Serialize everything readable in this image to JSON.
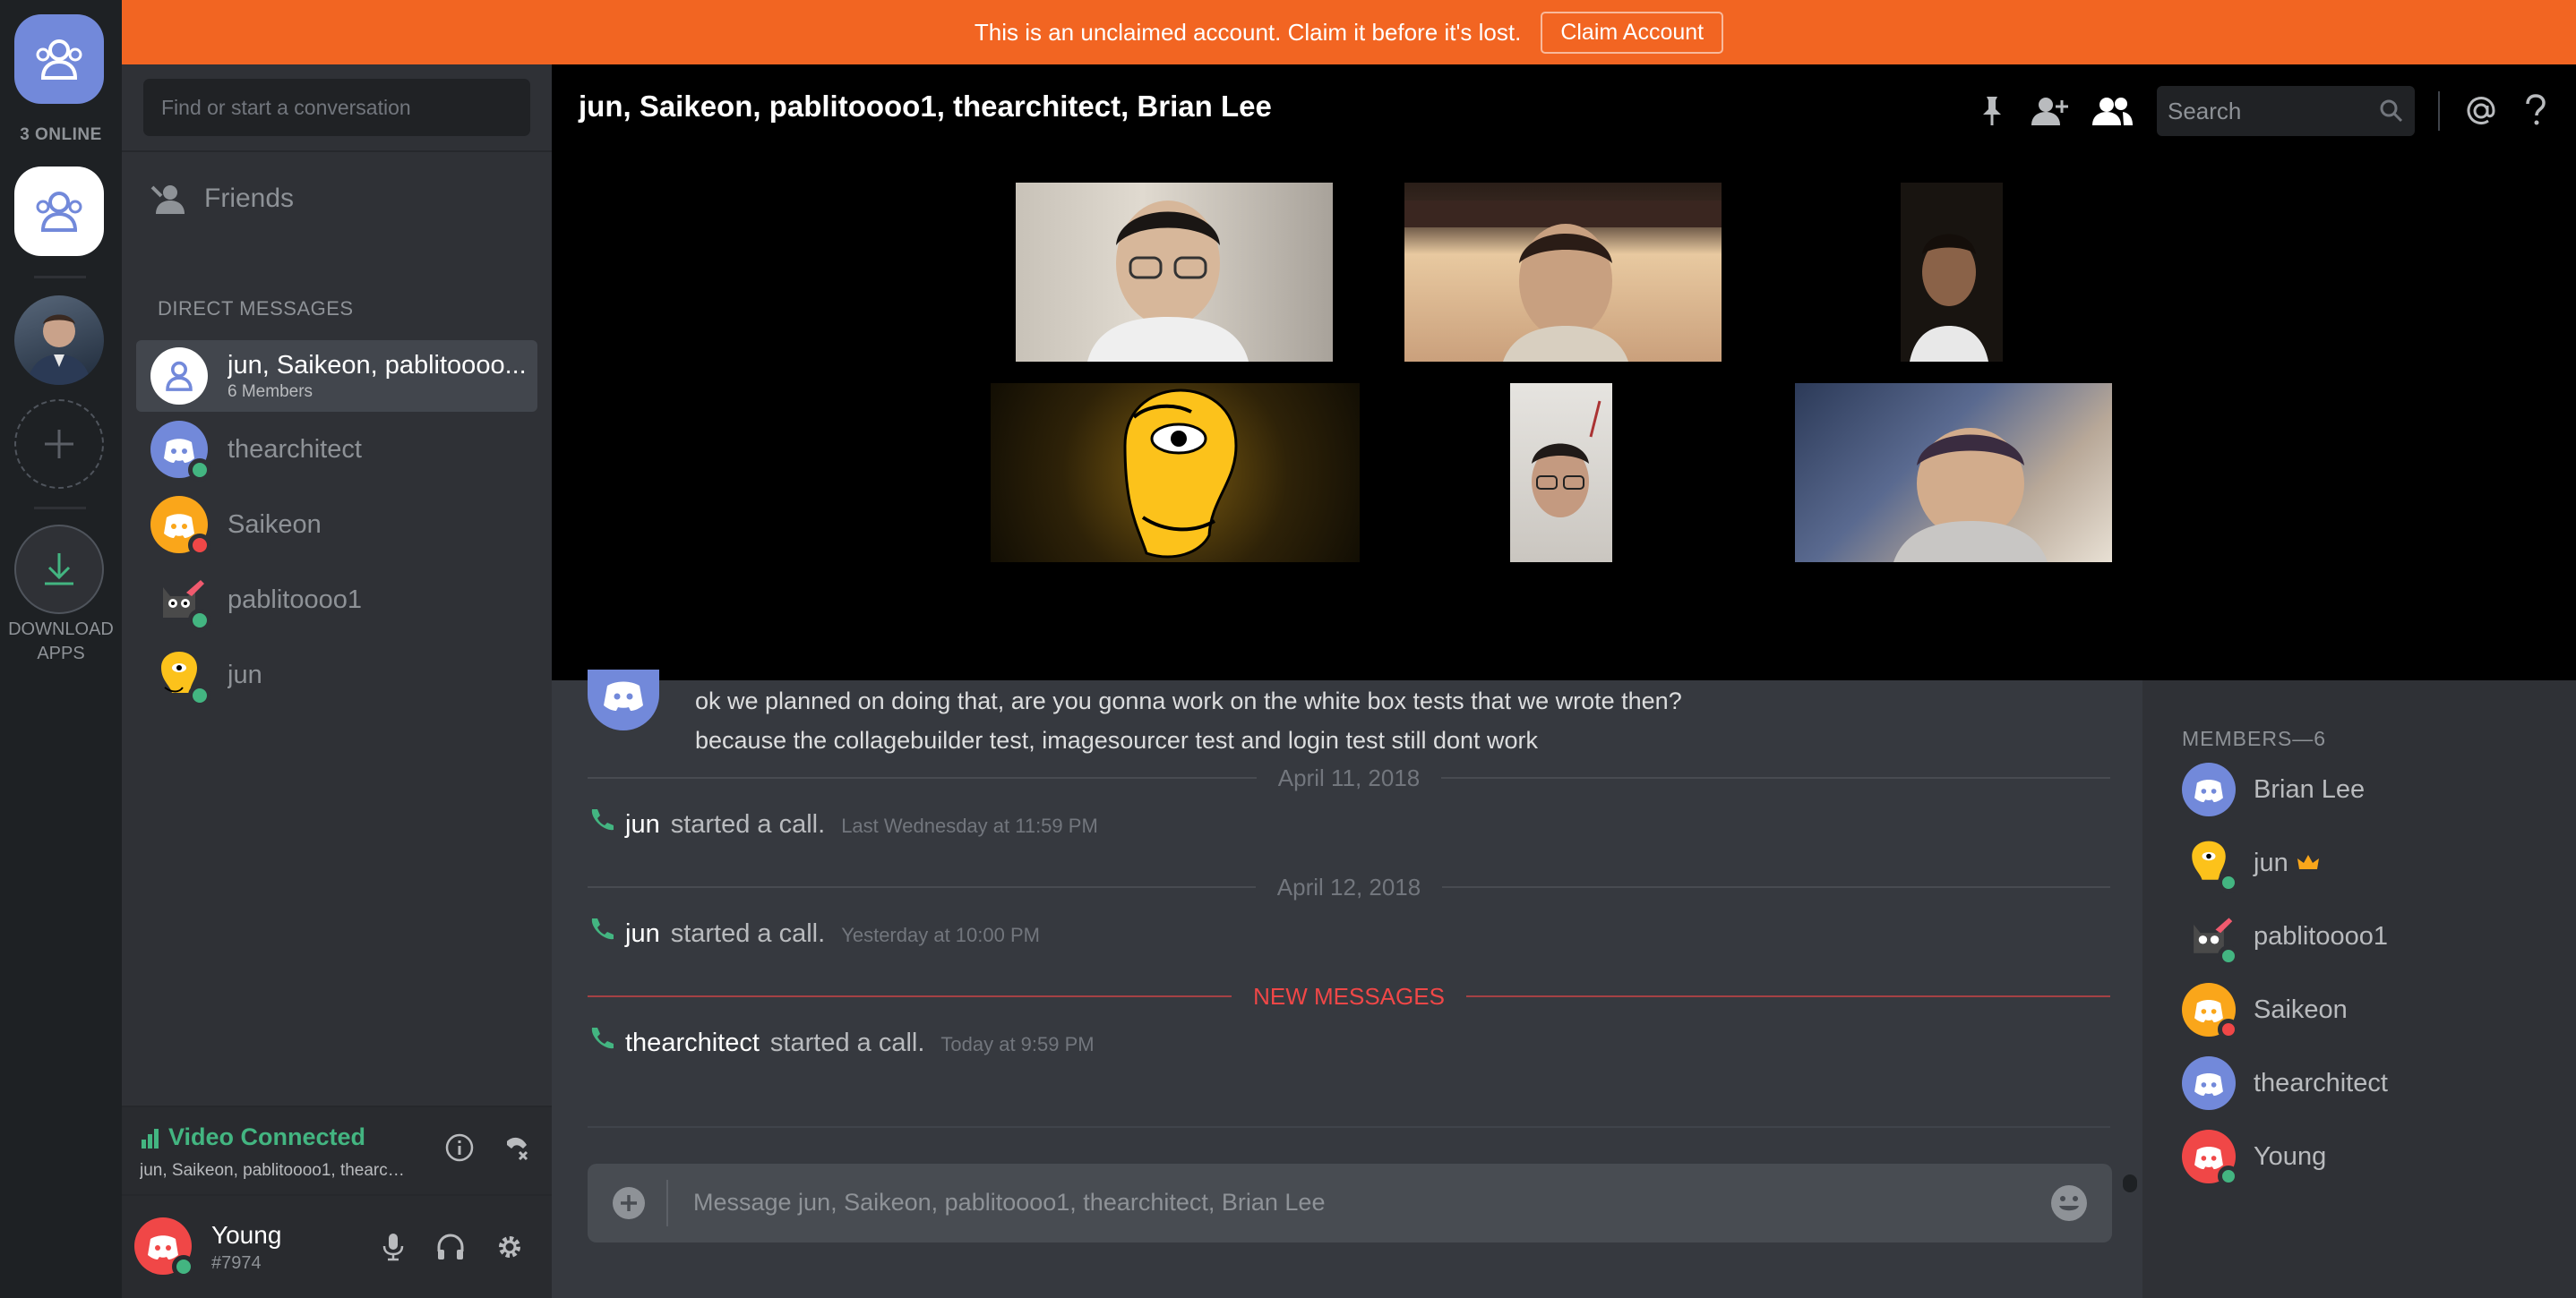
{
  "guilds": {
    "online_count": "3 ONLINE",
    "download_label_1": "DOWNLOAD",
    "download_label_2": "APPS"
  },
  "banner": {
    "text": "This is an unclaimed account. Claim it before it's lost.",
    "button": "Claim Account"
  },
  "dm_sidebar": {
    "search_placeholder": "Find or start a conversation",
    "friends_label": "Friends",
    "section_header": "DIRECT MESSAGES",
    "items": [
      {
        "name": "jun, Saikeon, pablitoooo...",
        "sub": "6 Members",
        "active": true
      },
      {
        "name": "thearchitect",
        "status": "online"
      },
      {
        "name": "Saikeon",
        "status": "dnd"
      },
      {
        "name": "pablitoooo1",
        "status": "online"
      },
      {
        "name": "jun",
        "status": "online"
      }
    ]
  },
  "voice": {
    "title": "Video Connected",
    "subtitle": "jun, Saikeon, pablitoooo1, thearch..."
  },
  "user": {
    "name": "Young",
    "tag": "#7974"
  },
  "channel": {
    "title": "jun, Saikeon, pablitoooo1, thearchitect, Brian Lee",
    "search_placeholder": "Search"
  },
  "messages": {
    "line1": "ok we planned on doing that, are you gonna work on the white box tests that we wrote then?",
    "line2": "because the collagebuilder test, imagesourcer test and login test still dont work",
    "day1": "April 11, 2018",
    "call1": {
      "name": "jun",
      "action": "started a call.",
      "time": "Last Wednesday at 11:59 PM"
    },
    "day2": "April 12, 2018",
    "call2": {
      "name": "jun",
      "action": "started a call.",
      "time": "Yesterday at 10:00 PM"
    },
    "new_label": "NEW MESSAGES",
    "call3": {
      "name": "thearchitect",
      "action": "started a call.",
      "time": "Today at 9:59 PM"
    }
  },
  "composer": {
    "placeholder": "Message jun, Saikeon, pablitoooo1, thearchitect, Brian Lee"
  },
  "members": {
    "header": "MEMBERS—6",
    "list": [
      {
        "name": "Brian Lee"
      },
      {
        "name": "jun",
        "owner": true
      },
      {
        "name": "pablitoooo1"
      },
      {
        "name": "Saikeon"
      },
      {
        "name": "thearchitect"
      },
      {
        "name": "Young"
      }
    ]
  },
  "colors": {
    "banner": "#f26522",
    "online": "#43b581",
    "dnd": "#f04747",
    "blurple": "#7289da",
    "saikeon": "#faa61a",
    "young": "#f04747"
  }
}
